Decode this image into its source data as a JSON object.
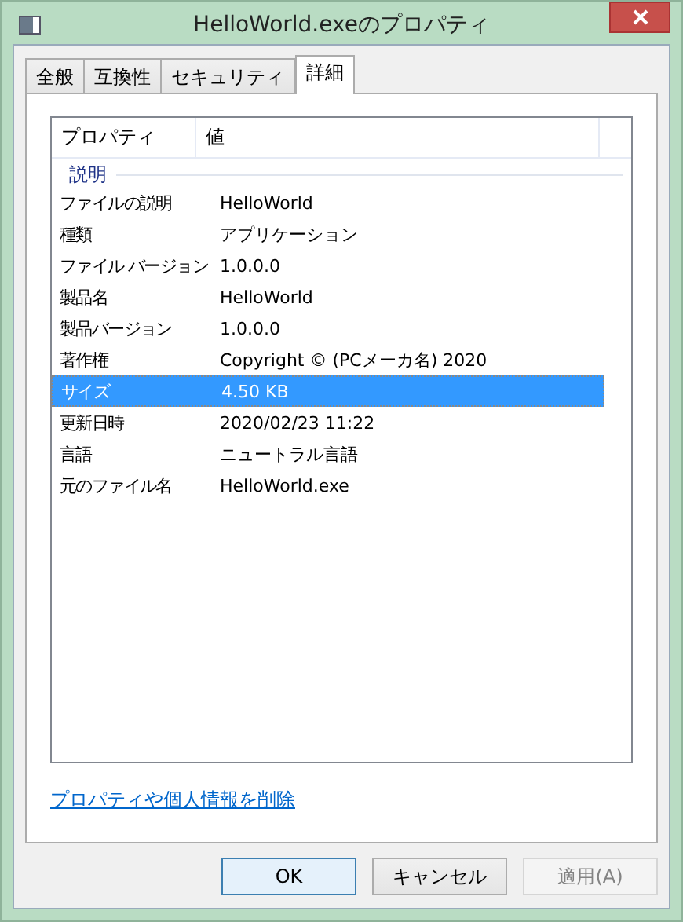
{
  "window": {
    "title": "HelloWorld.exeのプロパティ"
  },
  "tabs": [
    {
      "label": "全般",
      "selected": false
    },
    {
      "label": "互換性",
      "selected": false
    },
    {
      "label": "セキュリティ",
      "selected": false
    },
    {
      "label": "詳細",
      "selected": true
    }
  ],
  "table": {
    "columns": [
      "プロパティ",
      "値"
    ],
    "group": "説明",
    "rows": [
      {
        "property": "ファイルの説明",
        "value": "HelloWorld",
        "selected": false
      },
      {
        "property": "種類",
        "value": "アプリケーション",
        "selected": false
      },
      {
        "property": "ファイル バージョン",
        "value": "1.0.0.0",
        "selected": false
      },
      {
        "property": "製品名",
        "value": "HelloWorld",
        "selected": false
      },
      {
        "property": "製品バージョン",
        "value": "1.0.0.0",
        "selected": false
      },
      {
        "property": "著作権",
        "value": "Copyright © (PCメーカ名) 2020",
        "selected": false
      },
      {
        "property": "サイズ",
        "value": "4.50 KB",
        "selected": true
      },
      {
        "property": "更新日時",
        "value": "2020/02/23 11:22",
        "selected": false
      },
      {
        "property": "言語",
        "value": "ニュートラル言語",
        "selected": false
      },
      {
        "property": "元のファイル名",
        "value": "HelloWorld.exe",
        "selected": false
      }
    ]
  },
  "link": "プロパティや個人情報を削除",
  "buttons": [
    {
      "label": "OK",
      "default": true,
      "disabled": false
    },
    {
      "label": "キャンセル",
      "default": false,
      "disabled": false
    },
    {
      "label": "適用(A)",
      "default": false,
      "disabled": true
    }
  ]
}
